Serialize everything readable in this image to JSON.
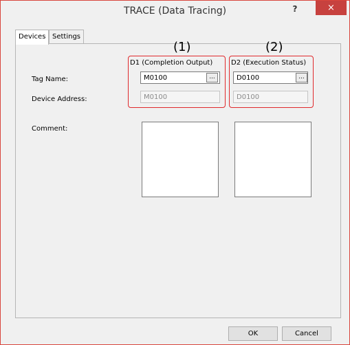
{
  "window": {
    "title": "TRACE (Data Tracing)",
    "help_label": "?",
    "close_label": "×"
  },
  "tabs": [
    {
      "label": "Devices",
      "active": true
    },
    {
      "label": "Settings",
      "active": false
    }
  ],
  "callouts": {
    "d1": "(1)",
    "d2": "(2)"
  },
  "columns": {
    "d1": "D1 (Completion Output)",
    "d2": "D2 (Execution Status)"
  },
  "rows": {
    "tag_name": "Tag Name:",
    "device_address": "Device Address:",
    "comment": "Comment:"
  },
  "fields": {
    "d1_tag": "M0100",
    "d1_address": "M0100",
    "d2_tag": "D0100",
    "d2_address": "D0100",
    "d1_comment": "",
    "d2_comment": ""
  },
  "browse_label": "...",
  "buttons": {
    "ok": "OK",
    "cancel": "Cancel"
  },
  "colors": {
    "close_bg": "#c7413e",
    "highlight": "#e0282b"
  }
}
